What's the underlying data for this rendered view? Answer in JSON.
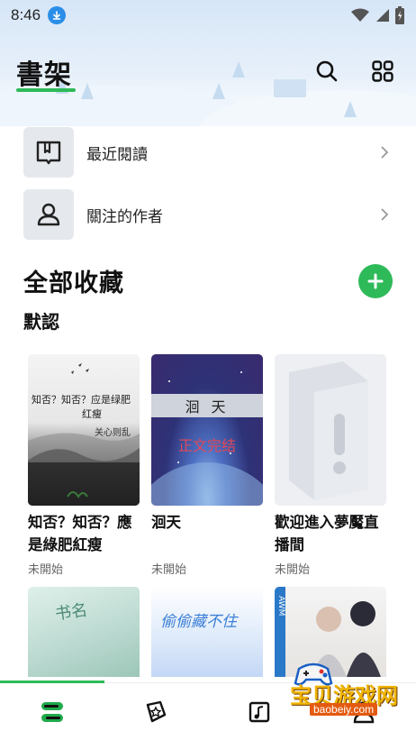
{
  "status": {
    "time": "8:46",
    "icons": [
      "download-icon",
      "wifi-icon",
      "signal-icon",
      "battery-icon"
    ]
  },
  "header": {
    "title": "書架",
    "accent_color": "#2fba5a",
    "actions": [
      "search-icon",
      "grid-icon"
    ]
  },
  "menu": [
    {
      "label": "最近閱讀",
      "icon": "book-open-icon"
    },
    {
      "label": "關注的作者",
      "icon": "person-icon"
    }
  ],
  "collection": {
    "title": "全部收藏",
    "group": "默認",
    "add_icon": "plus-icon"
  },
  "books": [
    {
      "title": "知否？知否？應是綠肥紅瘦",
      "status": "未開始",
      "cover_text": [
        "知否？知否？应是绿肥",
        "红瘦",
        "关心则乱"
      ]
    },
    {
      "title": "洄天",
      "status": "未開始",
      "cover_text": [
        "洄 天",
        "正文完结"
      ]
    },
    {
      "title": "歡迎進入夢魘直播間",
      "status": "未開始",
      "cover_text": []
    }
  ],
  "books_row2": [
    {
      "cover_text": "书名"
    },
    {
      "cover_text": "偷偷藏不住"
    },
    {
      "cover_text": "AWM"
    }
  ],
  "bottom_nav": [
    {
      "name": "bookshelf",
      "icon": "bookshelf-icon",
      "active": true
    },
    {
      "name": "discover",
      "icon": "star-icon",
      "active": false
    },
    {
      "name": "music",
      "icon": "music-icon",
      "active": false
    },
    {
      "name": "profile",
      "icon": "user-icon",
      "active": false
    }
  ],
  "watermark": {
    "text": "宝贝游戏网",
    "url": "baobeiy.com"
  }
}
